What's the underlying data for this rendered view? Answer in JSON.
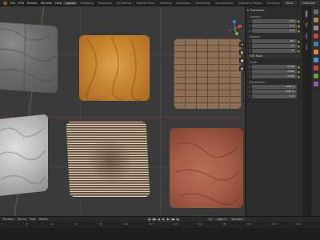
{
  "menubar": {
    "menus": [
      "File",
      "Edit",
      "Render",
      "Window",
      "Help"
    ],
    "workspaces": [
      {
        "label": "Layout",
        "active": true
      },
      {
        "label": "Modeling",
        "active": false
      },
      {
        "label": "Sculpting",
        "active": false
      },
      {
        "label": "UV Editing",
        "active": false
      },
      {
        "label": "Texture Paint",
        "active": false
      },
      {
        "label": "Shading",
        "active": false
      },
      {
        "label": "Animation",
        "active": false
      },
      {
        "label": "Rendering",
        "active": false
      },
      {
        "label": "Compositing",
        "active": false
      },
      {
        "label": "Geometry Nodes",
        "active": false
      },
      {
        "label": "Scripting",
        "active": false
      }
    ],
    "scene": "Scene",
    "view_layer": "ViewLayer"
  },
  "viewport": {
    "tiles": [
      {
        "name": "stone-tile",
        "material": "stone"
      },
      {
        "name": "orange-wood-tile",
        "material": "wood"
      },
      {
        "name": "brick-tile",
        "material": "brick"
      },
      {
        "name": "white-rock-tile",
        "material": "rock"
      },
      {
        "name": "striped-wood-tile",
        "material": "wood-stripes"
      },
      {
        "name": "clay-tile",
        "material": "clay"
      }
    ],
    "gizmo": {
      "axes": [
        "X",
        "Y",
        "Z"
      ],
      "colors": {
        "x": "#d94848",
        "y": "#7db03a",
        "z": "#3a7fd9"
      }
    }
  },
  "npanel": {
    "header": "Transform",
    "location": {
      "label": "Location:",
      "x": "0 m",
      "y": "0 m",
      "z": "0 m"
    },
    "rotation": {
      "label": "Rotation:",
      "x": "90°",
      "y": "0°",
      "z": "0°",
      "mode": "XYZ Euler"
    },
    "scale": {
      "label": "Scale:",
      "x": "0.000",
      "y": "0.000",
      "z": "0.000"
    },
    "dimensions": {
      "label": "Dimensions:",
      "x": "0.00 m",
      "y": "0.00 m",
      "z": "0 m"
    }
  },
  "side_tabs": [
    "Item",
    "Tool",
    "View",
    "Edit"
  ],
  "timeline": {
    "menus": [
      "Playback",
      "Keying",
      "View",
      "Marker"
    ],
    "playback_buttons": [
      "|◀",
      "◀◆",
      "◀",
      "▶",
      "▶|",
      "◆▶",
      "▶|"
    ],
    "frame_current": "1",
    "frame_start": "Start 1",
    "frame_end": "End 250",
    "ruler": [
      "0",
      "20",
      "40",
      "60",
      "80",
      "100",
      "120",
      "140",
      "160",
      "180",
      "200",
      "220",
      "240"
    ]
  },
  "colors": {
    "accent": "#4772b3",
    "viewport_bg": "#3a3a3a",
    "panel_bg": "#2b2b2b"
  }
}
